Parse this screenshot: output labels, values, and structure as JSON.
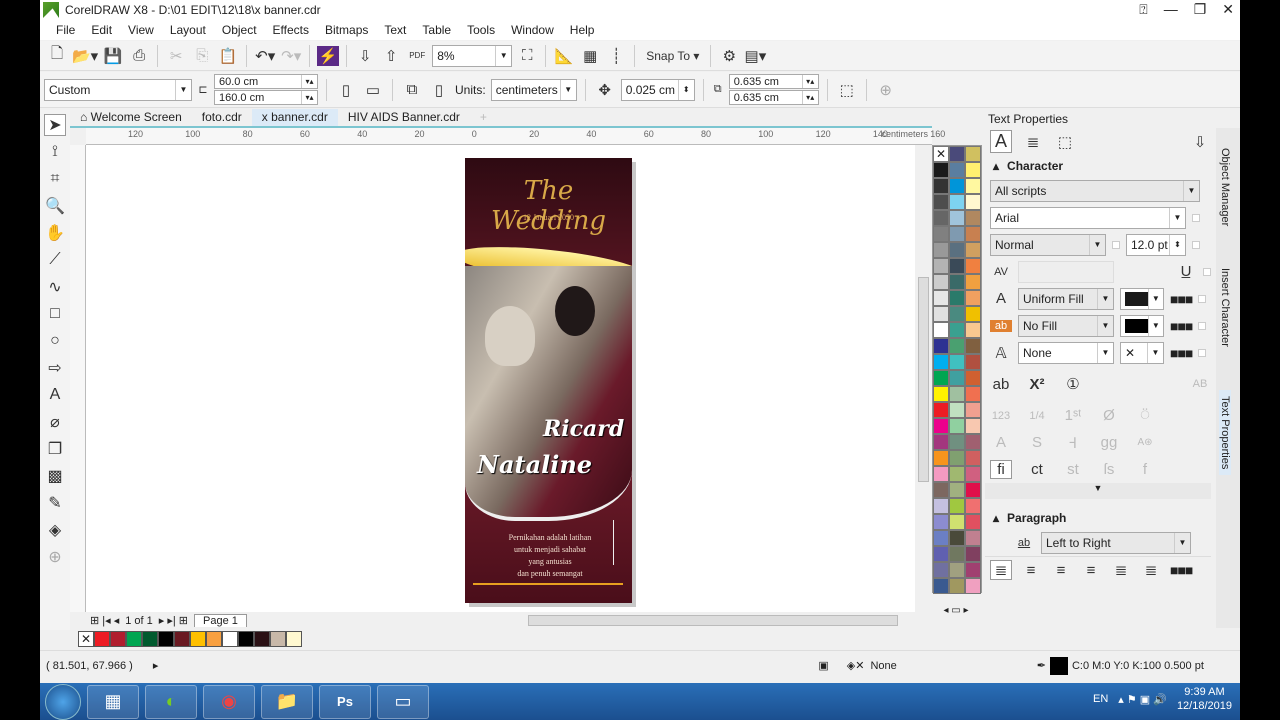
{
  "window": {
    "title": "CorelDRAW X8 - D:\\01 EDIT\\12\\18\\x banner.cdr"
  },
  "menu": [
    "File",
    "Edit",
    "View",
    "Layout",
    "Object",
    "Effects",
    "Bitmaps",
    "Text",
    "Table",
    "Tools",
    "Window",
    "Help"
  ],
  "toolbar": {
    "zoom": "8%",
    "snap_to": "Snap To"
  },
  "propbar": {
    "page_preset": "Custom",
    "width": "60.0 cm",
    "height": "160.0 cm",
    "units_label": "Units:",
    "units": "centimeters",
    "nudge": "0.025 cm",
    "dup_x": "0.635 cm",
    "dup_y": "0.635 cm"
  },
  "tabs": [
    {
      "label": "Welcome Screen"
    },
    {
      "label": "foto.cdr"
    },
    {
      "label": "x banner.cdr",
      "active": true
    },
    {
      "label": "HIV AIDS Banner.cdr"
    }
  ],
  "ruler": {
    "labels": [
      "120",
      "100",
      "80",
      "60",
      "40",
      "20",
      "0",
      "20",
      "40",
      "60",
      "80",
      "100",
      "120",
      "140",
      "160"
    ],
    "unit": "centimeters"
  },
  "banner": {
    "title": "The Wedding",
    "date": "12 Januari 2050",
    "groom": "Ricard",
    "bride": "Nataline",
    "quote": [
      "Pernikahan adalah latihan",
      "untuk menjadi sahabat",
      "yang antusias",
      "dan penuh semangat"
    ],
    "colors": {
      "maroon": "#6a1a28",
      "gold": "#e8b820"
    }
  },
  "palette": {
    "colors": [
      "none",
      "#4a4a7a",
      "#d0c060",
      "#1a1a1a",
      "#5a7ea0",
      "#fff070",
      "#333333",
      "#0095d9",
      "#fff8a0",
      "#4d4d4d",
      "#7dd3f0",
      "#fff8d0",
      "#666666",
      "#a0c4dc",
      "#b08860",
      "#808080",
      "#7f9ab0",
      "#c88050",
      "#999999",
      "#5a7080",
      "#d0a060",
      "#b3b3b3",
      "#3a4a58",
      "#f08040",
      "#cccccc",
      "#3a6a68",
      "#f0a040",
      "#e6e6e6",
      "#2a7a6a",
      "#f0a060",
      "#e0e0e0",
      "#4a8a80",
      "#f0c000",
      "#ffffff",
      "#3aa090",
      "#f8c890",
      "#2e3192",
      "#4aa070",
      "#806040",
      "#00aeef",
      "#40c0c0",
      "#b05040",
      "#00a651",
      "#40a0a0",
      "#d06030",
      "#fff200",
      "#a0c0a0",
      "#f07050",
      "#ed1c24",
      "#c0e0c0",
      "#f0a090",
      "#ec008c",
      "#90d0a0",
      "#f8c8b0",
      "#a3367e",
      "#709080",
      "#a06070",
      "#f7941d",
      "#80a070",
      "#d06060",
      "#f49ac1",
      "#a0b870",
      "#d06080",
      "#7c6760",
      "#a0b080",
      "#e0104a",
      "#c4c0e0",
      "#a0c840",
      "#f07070",
      "#8c8cd0",
      "#d0e070",
      "#e05060",
      "#6b7fc4",
      "#4a4a3a",
      "#c08090",
      "#6060b0",
      "#707860",
      "#804060",
      "#7070a0",
      "#a0a080",
      "#a04070",
      "#3a5a90",
      "#a09860",
      "#f0a0c0"
    ]
  },
  "docker": {
    "title": "Text Properties",
    "character": "Character",
    "scripts": "All scripts",
    "font": "Arial",
    "style": "Normal",
    "size": "12.0 pt",
    "text_fill": "Uniform Fill",
    "bg_fill": "No Fill",
    "outline": "None",
    "paragraph": "Paragraph",
    "direction": "Left to Right",
    "fill_color": "#1a1a1a"
  },
  "side_tabs": [
    "Object Manager",
    "Insert Character",
    "Text Properties"
  ],
  "pagenav": {
    "pages": "1 of 1",
    "page_tab": "Page 1"
  },
  "doc_palette": [
    "none",
    "#ed1c24",
    "#b01e2e",
    "#00a651",
    "#005a2e",
    "#000000",
    "#6a1a22",
    "#ffc000",
    "#f8a040",
    "#ffffff",
    "#000000",
    "#2a1014",
    "#c8b8a8",
    "#fff8d0"
  ],
  "status": {
    "coords": "( 81.501, 67.966 )",
    "fill": "None",
    "outline": "C:0 M:0 Y:0 K:100  0.500 pt"
  },
  "taskbar": {
    "lang": "EN",
    "time": "9:39 AM",
    "date": "12/18/2019"
  }
}
